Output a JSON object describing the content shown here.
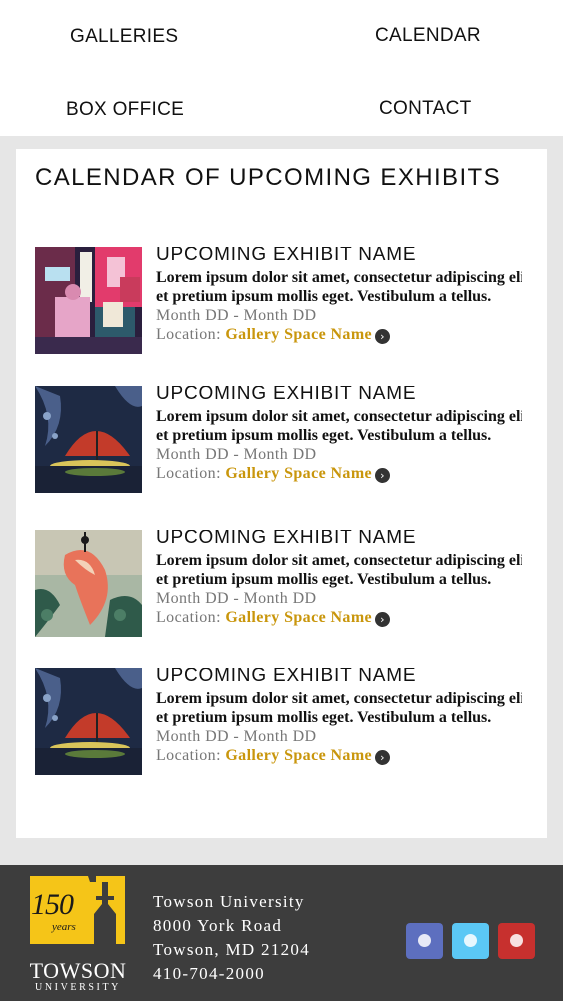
{
  "nav": {
    "galleries": "GALLERIES",
    "calendar": "CALENDAR",
    "box_office": "BOX OFFICE",
    "contact": "CONTACT"
  },
  "calendar": {
    "title": "CALENDAR OF UPCOMING EXHIBITS",
    "exhibits": [
      {
        "name": "UPCOMING EXHIBIT NAME",
        "desc_line1": "Lorem ipsum dolor sit amet, consectetur adipiscing elit.",
        "desc_line2": "et pretium ipsum mollis eget. Vestibulum a tellus.",
        "dates": "Month DD - Month DD",
        "location_label": "Location:",
        "gallery": "Gallery Space Name",
        "image": "street-market-painting"
      },
      {
        "name": "UPCOMING EXHIBIT NAME",
        "desc_line1": "Lorem ipsum dolor sit amet, consectetur adipiscing elit.",
        "desc_line2": "et pretium ipsum mollis eget. Vestibulum a tellus.",
        "dates": "Month DD - Month DD",
        "location_label": "Location:",
        "gallery": "Gallery Space Name",
        "image": "red-umbrella-night-painting"
      },
      {
        "name": "UPCOMING EXHIBIT NAME",
        "desc_line1": "Lorem ipsum dolor sit amet, consectetur adipiscing elit.",
        "desc_line2": "et pretium ipsum mollis eget. Vestibulum a tellus.",
        "dates": "Month DD - Month DD",
        "location_label": "Location:",
        "gallery": "Gallery Space Name",
        "image": "koi-fish-painting"
      },
      {
        "name": "UPCOMING EXHIBIT NAME",
        "desc_line1": "Lorem ipsum dolor sit amet, consectetur adipiscing elit.",
        "desc_line2": "et pretium ipsum mollis eget. Vestibulum a tellus.",
        "dates": "Month DD - Month DD",
        "location_label": "Location:",
        "gallery": "Gallery Space Name",
        "image": "red-umbrella-night-painting"
      }
    ]
  },
  "footer": {
    "logo_number": "150",
    "logo_years": "years",
    "logo_wordmark": "TOWSON",
    "logo_sub": "UNIVERSITY",
    "address": [
      "Towson University",
      "8000 York Road",
      "Towson, MD 21204",
      "410-704-2000"
    ],
    "social": [
      "facebook-icon",
      "twitter-icon",
      "instagram-icon"
    ]
  },
  "colors": {
    "accent_gold": "#c9960c",
    "footer_bg": "#3d3d3d",
    "logo_yellow": "#f5c518"
  }
}
